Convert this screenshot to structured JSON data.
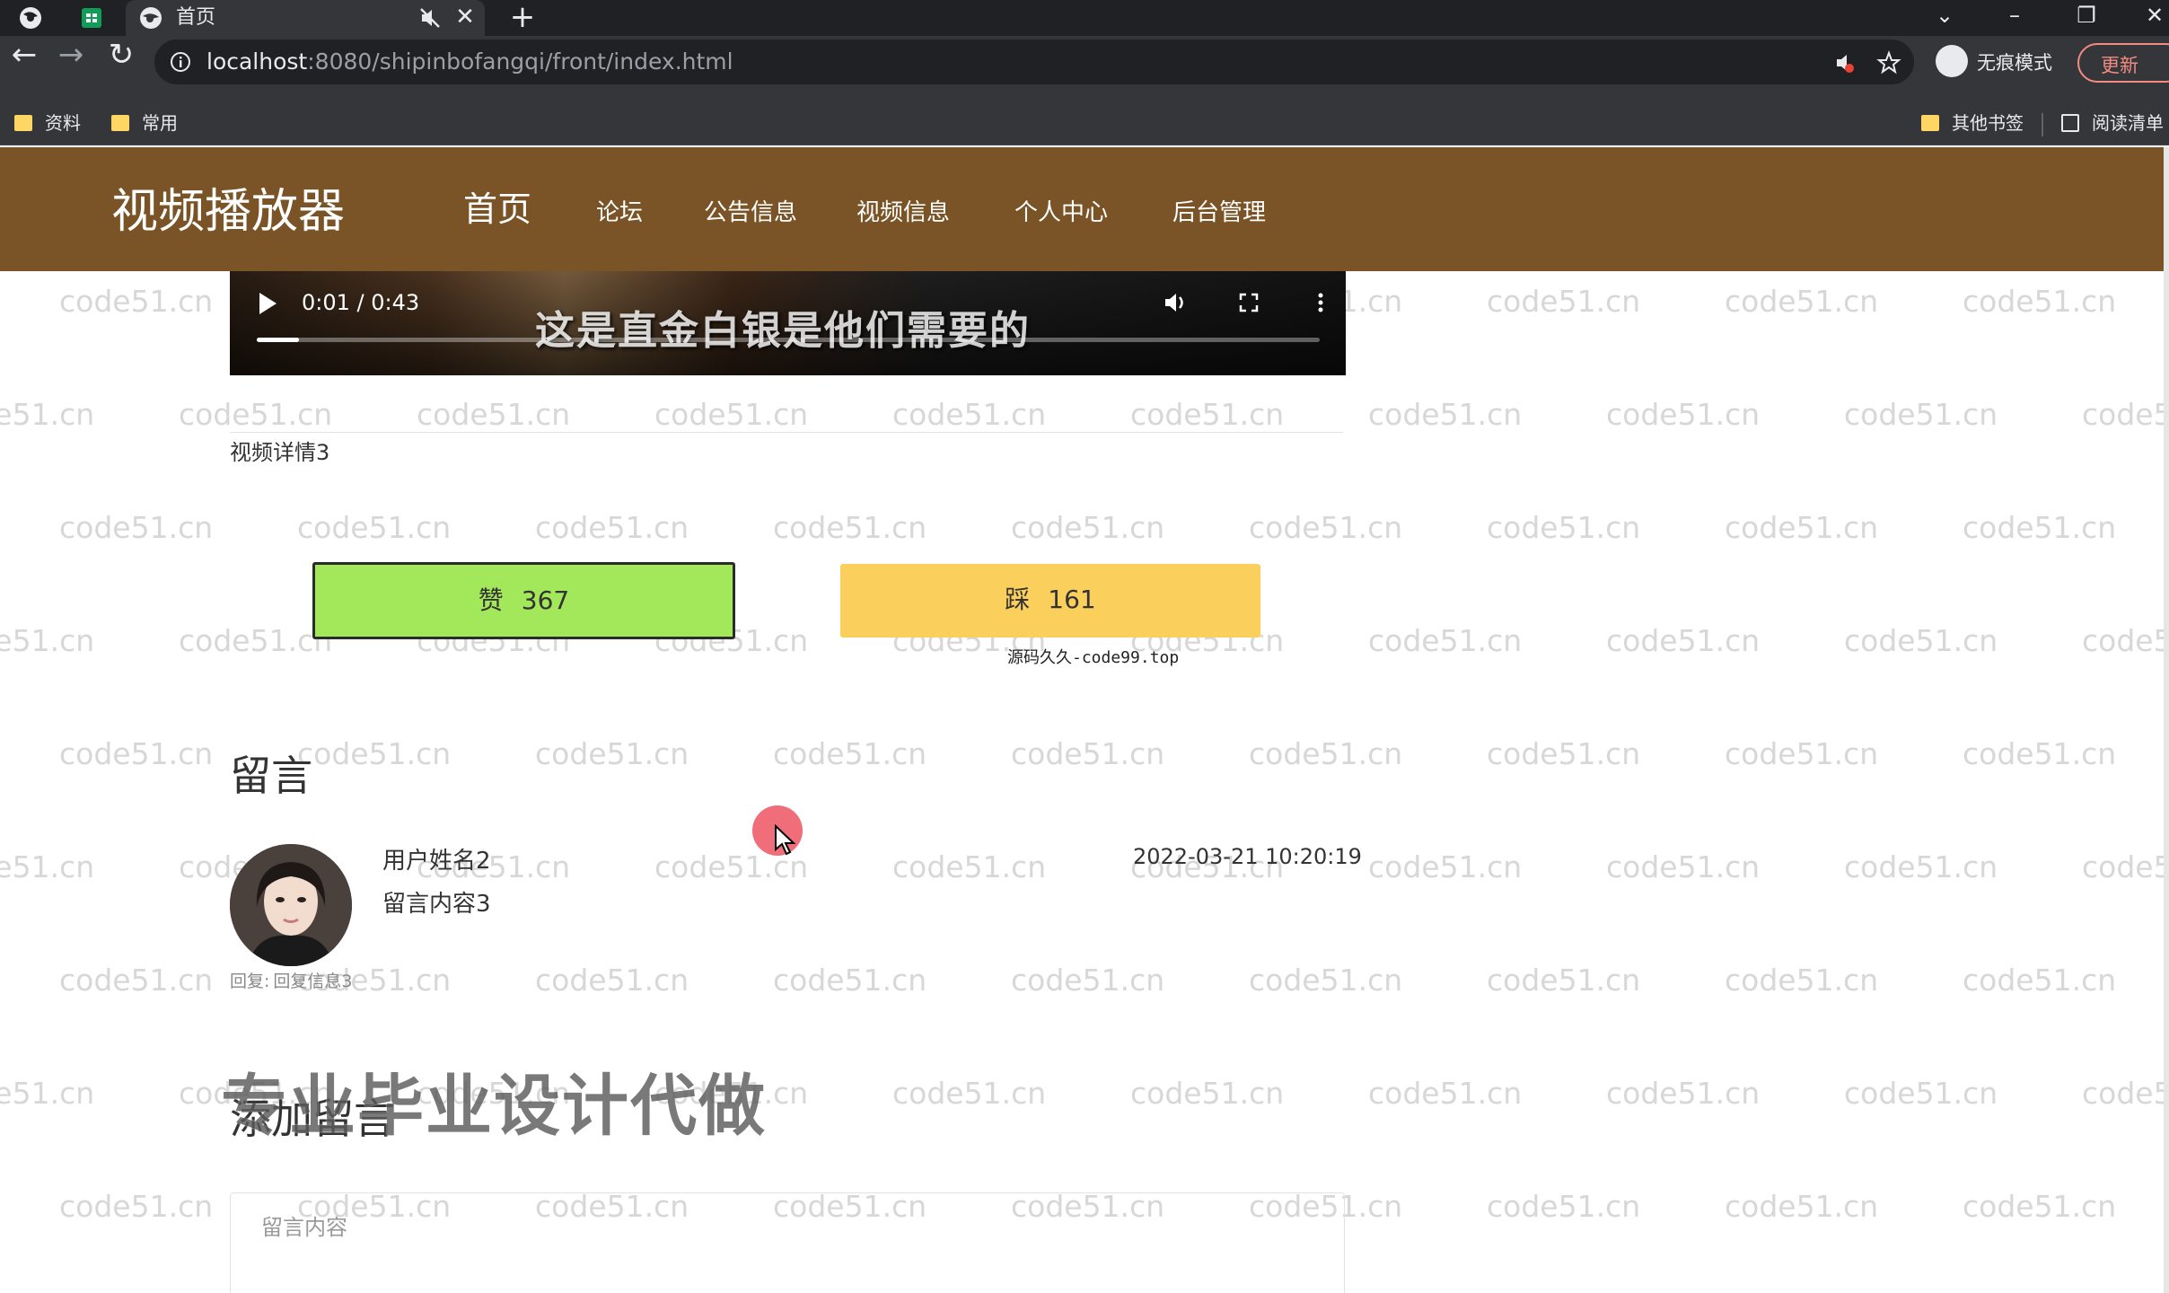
{
  "browser": {
    "tab_title": "首页",
    "url_host": "localhost",
    "url_rest": ":8080/shipinbofangqi/front/index.html",
    "profile_label": "无痕模式",
    "update_label": "更新",
    "bookmarks": {
      "left": [
        "资料",
        "常用"
      ],
      "other": "其他书签",
      "reading_list": "阅读清单"
    },
    "icons": [
      "back-icon",
      "forward-icon",
      "reload-icon",
      "info-icon",
      "star-icon",
      "mute-icon",
      "close-icon",
      "new-tab-icon"
    ]
  },
  "site": {
    "title": "视频播放器",
    "nav": [
      "首页",
      "论坛",
      "公告信息",
      "视频信息",
      "个人中心",
      "后台管理"
    ],
    "header_color": "#7a5426",
    "watermark": "code51.cn"
  },
  "video": {
    "time": "0:01 / 0:43",
    "progress": 0.04,
    "subtitle": "这是直金白银是他们需要的",
    "detail": "视频详情3"
  },
  "reactions": {
    "like_label": "赞",
    "like_count": "367",
    "like_color": "#a3e85b",
    "dislike_label": "踩",
    "dislike_count": "161",
    "dislike_color": "#fbcf5c",
    "source_note": "源码久久-code99.top"
  },
  "comments": {
    "title": "留言",
    "items": [
      {
        "user": "用户姓名2",
        "content": "留言内容3",
        "time": "2022-03-21 10:20:19",
        "reply_label": "回复:",
        "reply_text": "回复信息3"
      }
    ]
  },
  "overlay_text": "专业毕业设计代做",
  "add_comment": {
    "title": "添加留言",
    "placeholder": "留言内容"
  }
}
